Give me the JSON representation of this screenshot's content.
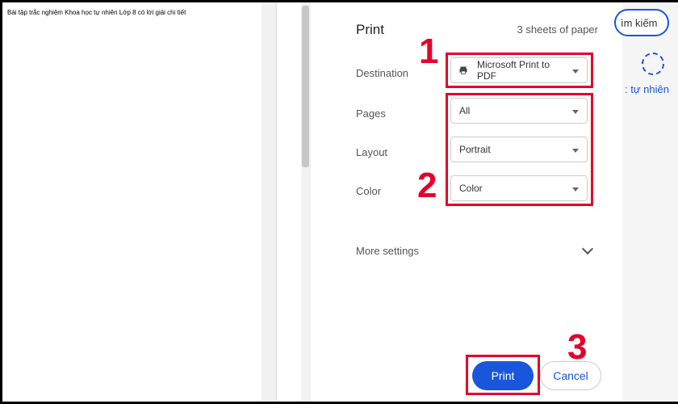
{
  "preview": {
    "document_title": "Bài tập trắc nghiệm Khoa học tự nhiên Lớp 8 có lời giải chi tiết"
  },
  "dialog": {
    "title": "Print",
    "sheets_text": "3 sheets of paper",
    "labels": {
      "destination": "Destination",
      "pages": "Pages",
      "layout": "Layout",
      "color": "Color",
      "more": "More settings"
    },
    "values": {
      "destination": "Microsoft Print to PDF",
      "pages": "All",
      "layout": "Portrait",
      "color": "Color"
    },
    "buttons": {
      "print": "Print",
      "cancel": "Cancel"
    }
  },
  "annotations": {
    "num1": "1",
    "num2": "2",
    "num3": "3"
  },
  "background_page": {
    "search_partial": "ìm kiếm",
    "link_partial": ": tự nhiên"
  },
  "colors": {
    "accent": "#1a56db",
    "annotation": "#e4002b"
  }
}
